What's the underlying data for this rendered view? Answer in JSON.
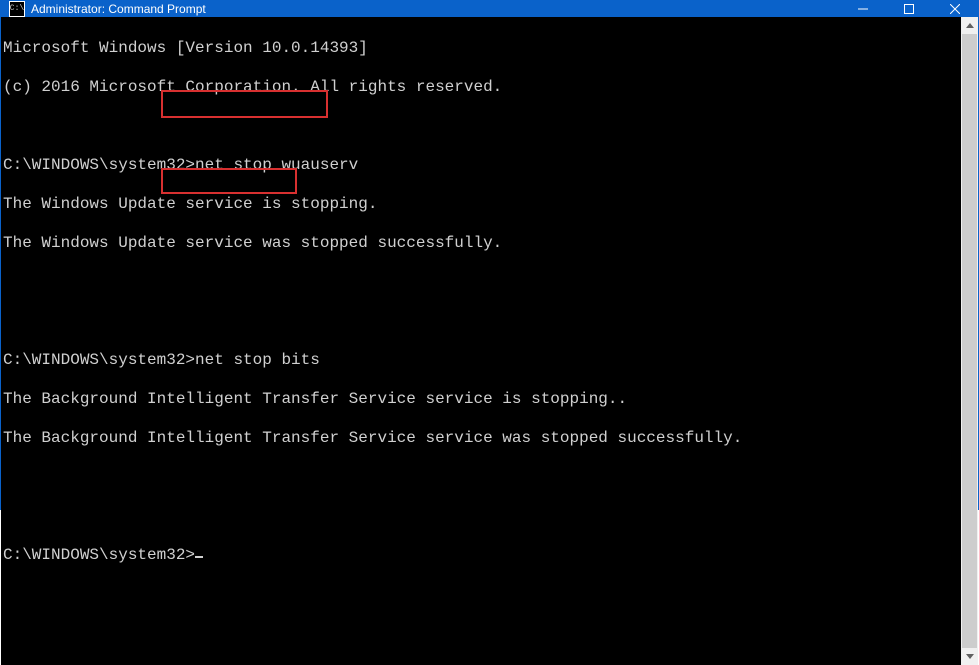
{
  "titlebar": {
    "icon_label": "C:\\",
    "title": "Administrator: Command Prompt"
  },
  "terminal": {
    "header1": "Microsoft Windows [Version 10.0.14393]",
    "header2": "(c) 2016 Microsoft Corporation. All rights reserved.",
    "prompt": "C:\\WINDOWS\\system32>",
    "cmd1": "net stop wuauserv",
    "out1a": "The Windows Update service is stopping.",
    "out1b": "The Windows Update service was stopped successfully.",
    "cmd2": "net stop bits",
    "out2a": "The Background Intelligent Transfer Service service is stopping..",
    "out2b": "The Background Intelligent Transfer Service service was stopped successfully."
  },
  "highlights": {
    "color": "#d83030"
  }
}
